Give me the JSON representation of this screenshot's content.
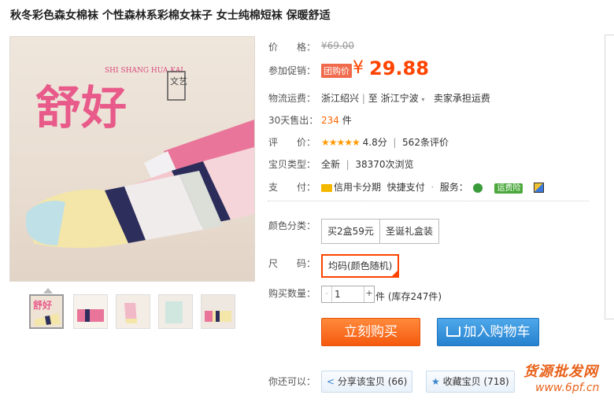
{
  "product": {
    "title": "秋冬彩色森女棉袜 个性森林系彩棉女袜子 女士纯棉短袜 保暖舒适",
    "image_text": {
      "brand_big": "舒好",
      "brand_small": "SHI SHANG HUA KAI",
      "seal": "文艺"
    }
  },
  "price": {
    "label": "价　　格：",
    "original": "¥69.00"
  },
  "promo": {
    "label": "参加促销：",
    "badge": "团购价",
    "currency": "¥",
    "value": "29.88"
  },
  "shipping": {
    "label": "物流运费：",
    "from": "浙江绍兴",
    "sep": "|",
    "to_prefix": "至",
    "to": "浙江宁波",
    "fee": "卖家承担运费"
  },
  "sales": {
    "label": "30天售出：",
    "count": "234",
    "unit": "件"
  },
  "rating": {
    "label": "评　　价：",
    "stars": "★★★★★",
    "score": "4.8分",
    "reviews": "562条评价"
  },
  "item_type": {
    "label": "宝贝类型：",
    "condition": "全新",
    "views": "38370次浏览"
  },
  "payment": {
    "label": "支　　付：",
    "credit": "信用卡分期",
    "quick": "快捷支付",
    "service_label": "服务：",
    "freight": "运费险"
  },
  "color": {
    "label": "颜色分类：",
    "options": [
      "买2盒59元",
      "圣诞礼盒装"
    ]
  },
  "size": {
    "label": "尺　　码：",
    "selected": "均码(颜色随机)"
  },
  "quantity": {
    "label": "购买数量：",
    "minus": "-",
    "value": "1",
    "plus": "+",
    "stock": "件 (库存247件)"
  },
  "actions": {
    "buy": "立刻购买",
    "cart": "加入购物车"
  },
  "share": {
    "label": "你还可以：",
    "share_btn": "分享该宝贝 (66)",
    "fav_btn": "收藏宝贝 (718)"
  },
  "watermark": {
    "cn": "货源批发网",
    "url": "www.6pf.cn"
  },
  "colors": {
    "accent": "#ff4400",
    "buy": "#f55a0e",
    "cart": "#2682cf"
  }
}
